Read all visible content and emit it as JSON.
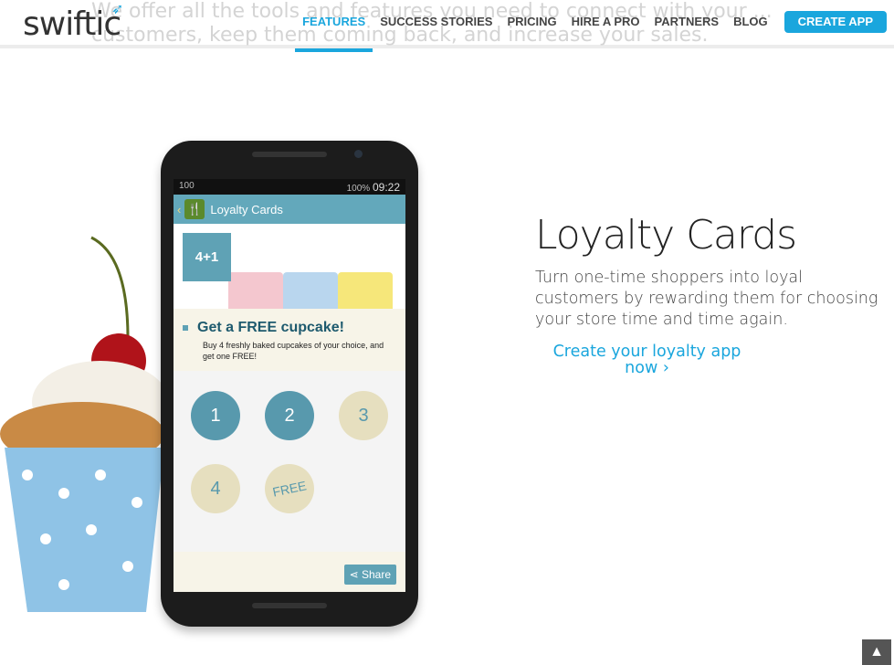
{
  "header": {
    "logo": "swiftic",
    "nav": [
      "FEATURES",
      "SUCCESS STORIES",
      "PRICING",
      "HIRE A PRO",
      "PARTNERS",
      "BLOG"
    ],
    "active": "FEATURES",
    "cta": "CREATE APP",
    "ghost_text": "We offer all the tools and features you need to connect with your ... customers, keep them coming back, and increase your sales."
  },
  "phone": {
    "status_left": "100",
    "status_battery": "100%",
    "status_time": "09:22",
    "app_title": "Loyalty Cards",
    "badge": "4+1",
    "offer_title": "Get a FREE cupcake!",
    "offer_text": "Buy 4 freshly baked cupcakes of your choice, and get one FREE!",
    "stamps": [
      "1",
      "2",
      "3",
      "4",
      "FREE"
    ],
    "stamps_filled": 2,
    "share": "Share"
  },
  "main": {
    "title": "Loyalty Cards",
    "description": "Turn one-time shoppers into loyal customers by rewarding them for choosing your store time and time again.",
    "link": "Create your loyalty app now ›"
  },
  "colors": {
    "accent": "#1aa6dd",
    "app_bar": "#63a8bb"
  }
}
